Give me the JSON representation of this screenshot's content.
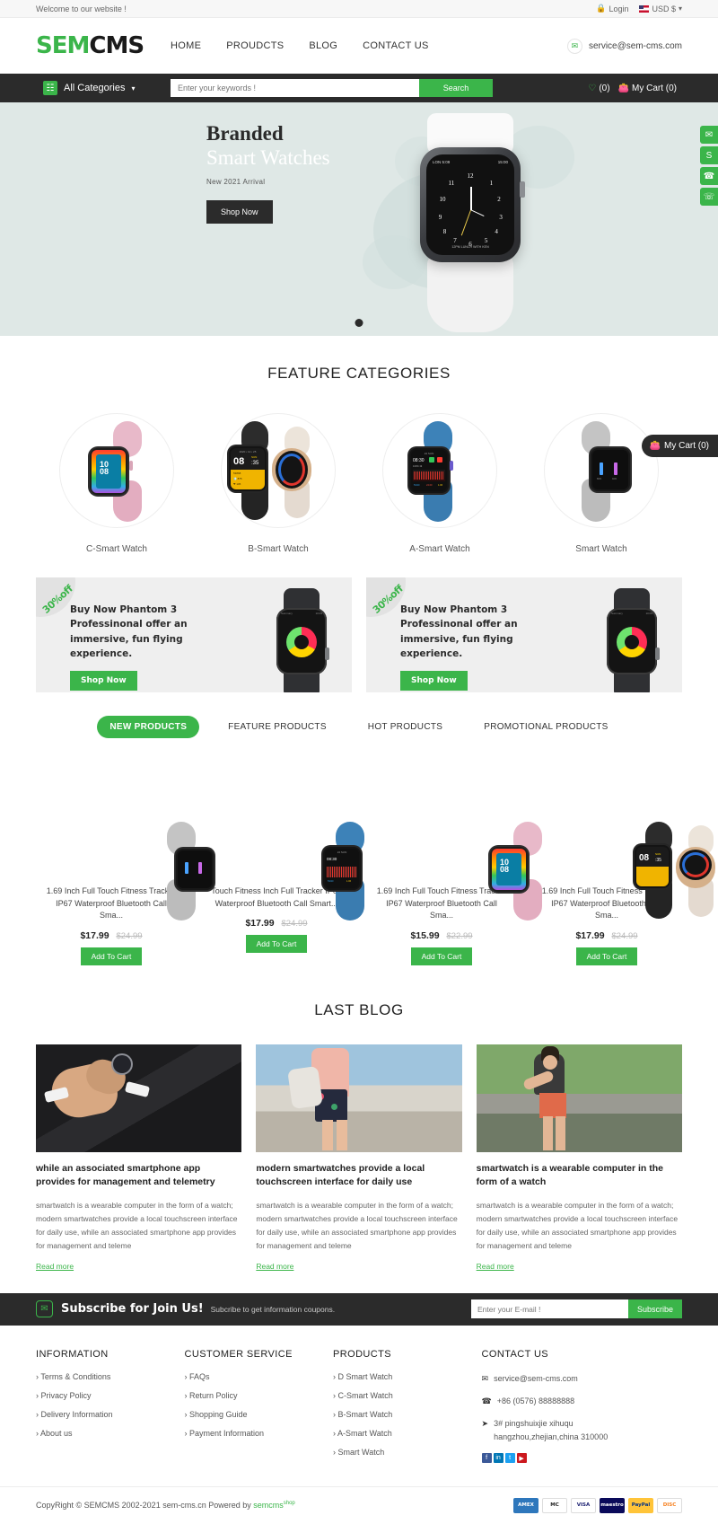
{
  "topbar": {
    "welcome": "Welcome to our website !",
    "login": "Login",
    "currency": "USD $",
    "lock_icon": "lock-icon",
    "chevron_icon": "chevron-down-icon"
  },
  "header": {
    "logo_green": "SEM",
    "logo_black": "CMS",
    "nav": [
      {
        "label": "HOME"
      },
      {
        "label": "PROUDCTS"
      },
      {
        "label": "BLOG"
      },
      {
        "label": "CONTACT US"
      }
    ],
    "email": "service@sem-cms.com",
    "mail_icon": "envelope-icon"
  },
  "searchbar": {
    "categories_label": "All Categories",
    "grid_icon": "grid-icon",
    "chevron_icon": "chevron-down-icon",
    "placeholder": "Enter your keywords !",
    "value": "",
    "search_label": "Search",
    "wishlist_count": "(0)",
    "heart_icon": "heart-icon",
    "cart_icon": "cart-icon",
    "cart_label": "My Cart (0)"
  },
  "hero": {
    "title_line1": "Branded",
    "title_line2": "Smart Watches",
    "subtitle": "New 2021 Arrival",
    "cta": "Shop Now",
    "watch_time_label": "LON 5:09",
    "watch_time_right": "15:00",
    "watch_brand": "12PM LUNCH WITH KEN"
  },
  "rail": {
    "items": [
      {
        "name": "email-icon",
        "glyph": "✉"
      },
      {
        "name": "skype-icon",
        "glyph": "S"
      },
      {
        "name": "whatsapp-icon",
        "glyph": "✆"
      },
      {
        "name": "phone-icon",
        "glyph": "☎"
      }
    ]
  },
  "floating_cart": {
    "label": "My Cart (0)",
    "icon": "cart-icon"
  },
  "feature_categories": {
    "title": "FEATURE CATEGORIES",
    "items": [
      {
        "label": "C-Smart Watch",
        "band": "#e8b9c9",
        "case": "#1d1d1d",
        "screen": "rainbow"
      },
      {
        "label": "B-Smart Watch",
        "band": "#2c2c2c",
        "case": "#1a1a1a",
        "screen": "yellow"
      },
      {
        "label": "A-Smart Watch",
        "band": "#3d82b8",
        "case": "#141414",
        "screen": "chart"
      },
      {
        "label": "Smart Watch",
        "band": "#c4c4c4",
        "case": "#181818",
        "screen": "dark"
      }
    ]
  },
  "promos": [
    {
      "badge": "30%off",
      "text": "Buy Now Phantom 3 Professinonal offer an immersive, fun flying experience.",
      "cta": "Shop Now"
    },
    {
      "badge": "30%off",
      "text": "Buy Now Phantom 3 Professinonal offer an immersive, fun flying experience.",
      "cta": "Shop Now"
    }
  ],
  "product_tabs": [
    {
      "label": "NEW PRODUCTS",
      "active": true
    },
    {
      "label": "FEATURE PRODUCTS",
      "active": false
    },
    {
      "label": "HOT PRODUCTS",
      "active": false
    },
    {
      "label": "PROMOTIONAL PRODUCTS",
      "active": false
    }
  ],
  "products": [
    {
      "title": "1.69 Inch Full Touch Fitness Tracker IP67 Waterproof Bluetooth Call Sma...",
      "price": "$17.99",
      "old_price": "$24.99",
      "cta": "Add To Cart",
      "band": "#c9c9c9",
      "case": "#1a1a1a",
      "screen": "dark"
    },
    {
      "title": "Touch Fitness Inch Full Tracker IP67 Waterproof Bluetooth Call Smart...",
      "price": "$17.99",
      "old_price": "$24.99",
      "cta": "Add To Cart",
      "band": "#3d82b8",
      "case": "#141414",
      "screen": "chart"
    },
    {
      "title": "1.69 Inch Full Touch Fitness Tracker IP67 Waterproof Bluetooth Call Sma...",
      "price": "$15.99",
      "old_price": "$22.99",
      "cta": "Add To Cart",
      "band": "#e8b9c9",
      "case": "#1d1d1d",
      "screen": "rainbow"
    },
    {
      "title": "1.69 Inch Full Touch Fitness Tracker IP67 Waterproof Bluetooth Call Sma...",
      "price": "$17.99",
      "old_price": "$24.99",
      "cta": "Add To Cart",
      "band": "#2c2c2c",
      "case": "#1a1a1a",
      "screen": "yellow"
    }
  ],
  "blog": {
    "title": "LAST BLOG",
    "posts": [
      {
        "title": "while an associated smartphone app provides for management and telemetry",
        "body": "smartwatch is a wearable computer in the form of a watch; modern smartwatches provide a local touchscreen interface for daily use, while an associated smartphone app provides for management and teleme",
        "more": "Read more"
      },
      {
        "title": "modern smartwatches provide a local touchscreen interface for daily use",
        "body": "smartwatch is a wearable computer in the form of a watch; modern smartwatches provide a local touchscreen interface for daily use, while an associated smartphone app provides for management and teleme",
        "more": "Read more"
      },
      {
        "title": "smartwatch is a wearable computer in the form of a watch",
        "body": "smartwatch is a wearable computer in the form of a watch; modern smartwatches provide a local touchscreen interface for daily use, while an associated smartphone app provides for management and teleme",
        "more": "Read more"
      }
    ]
  },
  "subscribe": {
    "icon": "envelope-icon",
    "title": "Subscribe for Join Us!",
    "subtitle": "Subcribe to get information coupons.",
    "placeholder": "Enter your E-mail !",
    "value": "",
    "button": "Subscribe"
  },
  "footer": {
    "columns": [
      {
        "title": "INFORMATION",
        "links": [
          "› Terms & Conditions",
          "› Privacy Policy",
          "› Delivery Information",
          "› About us"
        ]
      },
      {
        "title": "CUSTOMER SERVICE",
        "links": [
          "› FAQs",
          "› Return Policy",
          "› Shopping Guide",
          "› Payment Information"
        ]
      },
      {
        "title": "PRODUCTS",
        "links": [
          "› D Smart Watch",
          "› C-Smart Watch",
          "› B-Smart Watch",
          "› A-Smart Watch",
          "› Smart Watch"
        ]
      }
    ],
    "contact": {
      "title": "CONTACT US",
      "email": "service@sem-cms.com",
      "phone": "+86 (0576) 88888888",
      "address_line1": "3# pingshuixjie xihuqu",
      "address_line2": "hangzhou,zhejian,china 310000",
      "email_icon": "envelope-icon",
      "phone_icon": "phone-icon",
      "location_icon": "location-icon",
      "socials": [
        {
          "name": "facebook-icon",
          "glyph": "f",
          "color": "#3b5998"
        },
        {
          "name": "linkedin-icon",
          "glyph": "in",
          "color": "#0077b5"
        },
        {
          "name": "twitter-icon",
          "glyph": "t",
          "color": "#1da1f2"
        },
        {
          "name": "youtube-icon",
          "glyph": "▶",
          "color": "#cc181e"
        }
      ]
    }
  },
  "copyright": {
    "text": "CopyRight © SEMCMS 2002-2021 sem-cms.cn Powered by ",
    "brand": "semcms",
    "brand_sup": "shop",
    "payments": [
      {
        "name": "amex",
        "label": "AMERICAN EXPRESS",
        "color": "#2e77bc"
      },
      {
        "name": "mastercard",
        "label": "MasterCard",
        "color": "#eb001b"
      },
      {
        "name": "visa",
        "label": "VISA",
        "color": "#1a1f71"
      },
      {
        "name": "maestro",
        "label": "maestro",
        "color": "#0a0a5a"
      },
      {
        "name": "paypal",
        "label": "PayPal",
        "color": "#ffc439"
      },
      {
        "name": "discover",
        "label": "DISCOVER",
        "color": "#f68121"
      }
    ]
  }
}
